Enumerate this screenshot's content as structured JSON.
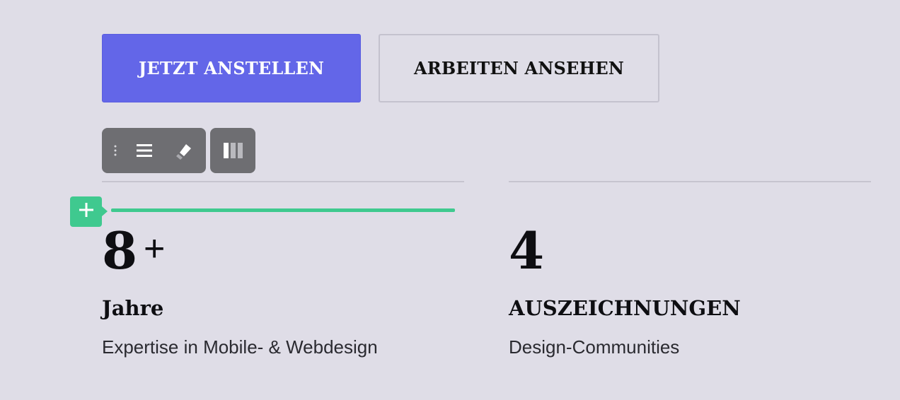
{
  "buttons": {
    "primary_label": "JETZT ANSTELLEN",
    "secondary_label": "ARBEITEN ANSEHEN"
  },
  "toolbar": {
    "icons": [
      "drag-handle-icon",
      "align-justify-icon",
      "highlighter-icon",
      "columns-icon"
    ]
  },
  "colors": {
    "accent": "#6366e8",
    "insert_indicator": "#3fc98f",
    "toolbar_bg": "#6e6e72",
    "background": "#dfdde7"
  },
  "stats": [
    {
      "number": "8",
      "suffix": "+",
      "label": "Jahre",
      "description": "Expertise in Mobile- & Webdesign"
    },
    {
      "number": "4",
      "suffix": "",
      "label": "AUSZEICHNUNGEN",
      "description": "Design-Communities"
    }
  ]
}
